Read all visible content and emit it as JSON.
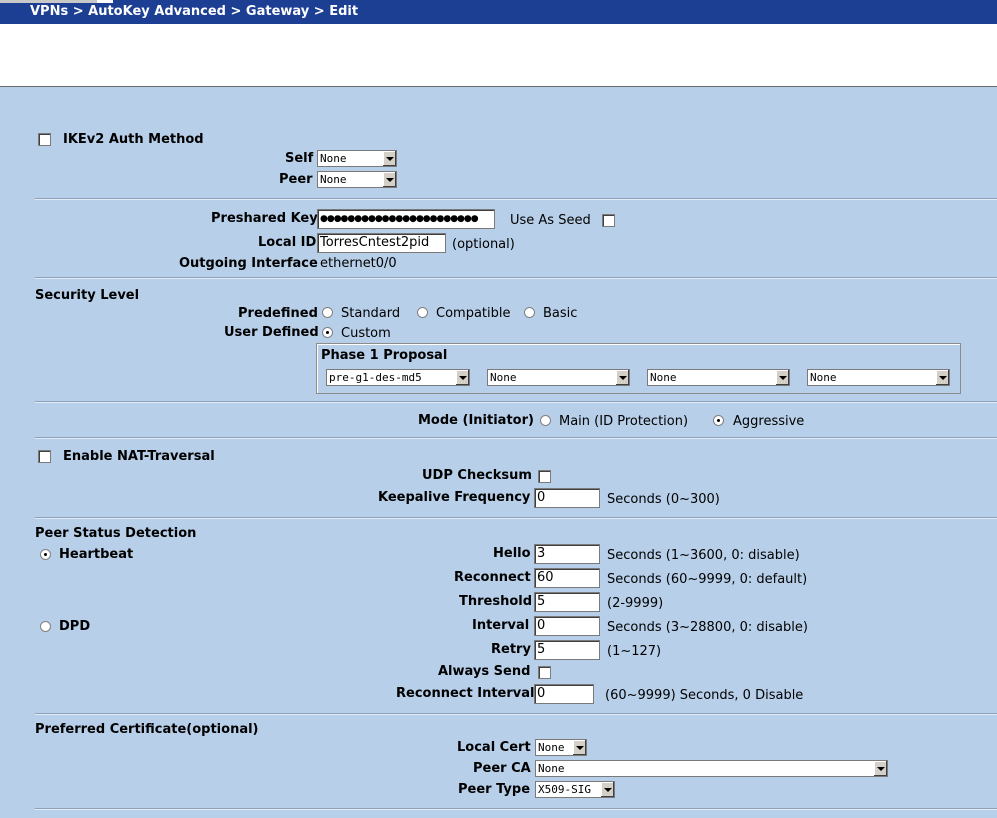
{
  "breadcrumb": "VPNs > AutoKey Advanced > Gateway > Edit",
  "ikev2": {
    "label": "IKEv2 Auth Method",
    "self_label": "Self",
    "self_value": "None",
    "peer_label": "Peer",
    "peer_value": "None"
  },
  "preshared": {
    "label": "Preshared Key",
    "value": "●●●●●●●●●●●●●●●●●●●●●●●",
    "seed_label": "Use As Seed"
  },
  "local_id": {
    "label": "Local ID",
    "value": "TorresCntest2pid",
    "hint": "(optional)"
  },
  "outgoing": {
    "label": "Outgoing Interface",
    "value": "ethernet0/0"
  },
  "security": {
    "heading": "Security Level",
    "predefined_label": "Predefined",
    "opt_standard": "Standard",
    "opt_compatible": "Compatible",
    "opt_basic": "Basic",
    "user_defined_label": "User Defined",
    "opt_custom": "Custom",
    "phase1_label": "Phase 1 Proposal",
    "proposals": [
      "pre-g1-des-md5",
      "None",
      "None",
      "None"
    ]
  },
  "mode": {
    "label": "Mode (Initiator)",
    "main": "Main (ID Protection)",
    "aggressive": "Aggressive"
  },
  "nat": {
    "label": "Enable NAT-Traversal",
    "udp_label": "UDP Checksum",
    "keepalive_label": "Keepalive Frequency",
    "keepalive_value": "0",
    "keepalive_hint": "Seconds (0~300)"
  },
  "psd": {
    "heading": "Peer Status Detection",
    "heartbeat_label": "Heartbeat",
    "hello_label": "Hello",
    "hello_value": "3",
    "hello_hint": "Seconds (1~3600, 0: disable)",
    "reconnect_label": "Reconnect",
    "reconnect_value": "60",
    "reconnect_hint": "Seconds (60~9999, 0: default)",
    "threshold_label": "Threshold",
    "threshold_value": "5",
    "threshold_hint": "(2-9999)",
    "dpd_label": "DPD",
    "interval_label": "Interval",
    "interval_value": "0",
    "interval_hint": "Seconds (3~28800, 0: disable)",
    "retry_label": "Retry",
    "retry_value": "5",
    "retry_hint": "(1~127)",
    "always_label": "Always Send",
    "reconint_label": "Reconnect Interval",
    "reconint_value": "0",
    "reconint_hint": "(60~9999) Seconds, 0 Disable"
  },
  "cert": {
    "heading": "Preferred Certificate(optional)",
    "local_label": "Local Cert",
    "local_value": "None",
    "peerca_label": "Peer CA",
    "peerca_value": "None",
    "peertype_label": "Peer Type",
    "peertype_value": "X509-SIG"
  },
  "colors": {
    "titlebar": "#1c3f94",
    "panel": "#b7cfe9"
  }
}
